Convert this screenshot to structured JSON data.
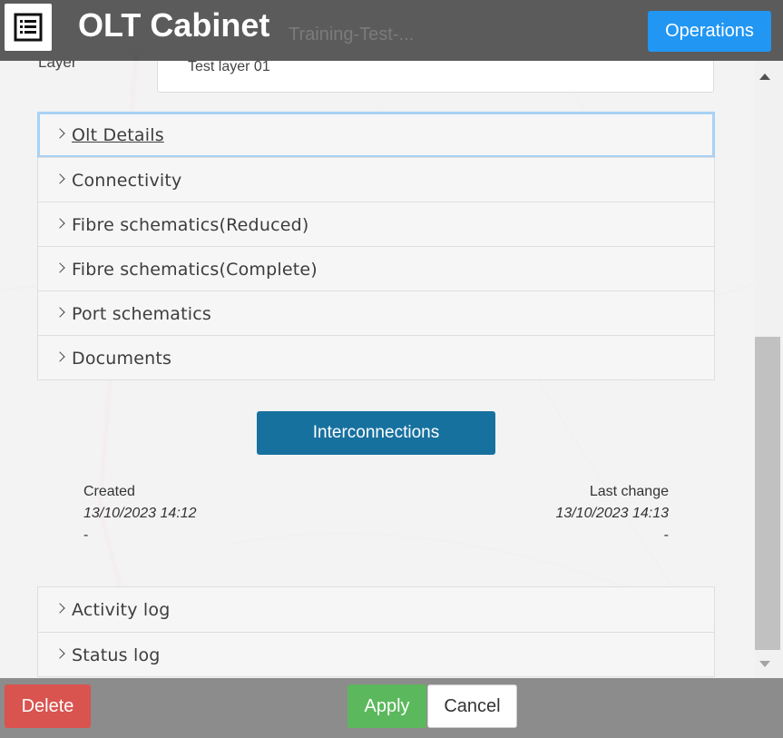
{
  "header": {
    "title": "OLT Cabinet",
    "background_text": "Training-Test-...",
    "operations_label": "Operations",
    "icon": "list-icon"
  },
  "layer": {
    "label": "Layer",
    "value": "Test layer 01"
  },
  "accordion_top": [
    {
      "label": "Olt Details",
      "focused": true
    },
    {
      "label": "Connectivity"
    },
    {
      "label": "Fibre schematics(Reduced)"
    },
    {
      "label": "Fibre schematics(Complete)"
    },
    {
      "label": "Port schematics"
    },
    {
      "label": "Documents"
    }
  ],
  "interconnections_label": "Interconnections",
  "meta": {
    "created_label": "Created",
    "created_date": "13/10/2023 14:12",
    "created_by": "-",
    "last_change_label": "Last change",
    "last_change_date": "13/10/2023 14:13",
    "last_change_by": "-"
  },
  "accordion_bottom": [
    {
      "label": "Activity log"
    },
    {
      "label": "Status log"
    }
  ],
  "footer": {
    "delete_label": "Delete",
    "apply_label": "Apply",
    "cancel_label": "Cancel"
  },
  "colors": {
    "header_bg": "#4e4e4e",
    "operations": "#2196f3",
    "interconnections": "#17719f",
    "delete": "#d9534f",
    "apply": "#5cb85c"
  }
}
